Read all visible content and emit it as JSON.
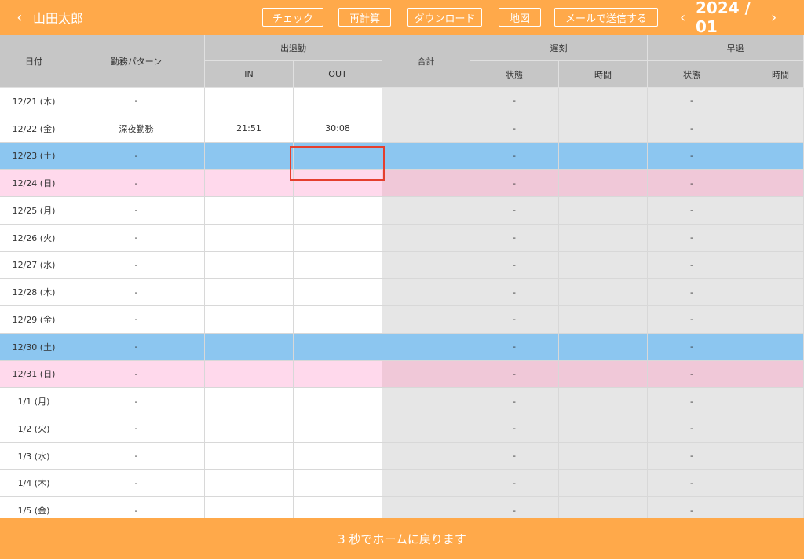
{
  "header": {
    "user_name": "山田太郎",
    "buttons": {
      "check": "チェック",
      "recalc": "再計算",
      "download": "ダウンロード",
      "map": "地図",
      "send_mail": "メールで送信する"
    },
    "month": "2024 / 01"
  },
  "table": {
    "headers": {
      "date": "日付",
      "pattern": "勤務パターン",
      "attendance": "出退勤",
      "in": "IN",
      "out": "OUT",
      "total": "合計",
      "late": "遅刻",
      "early": "早退",
      "status": "状態",
      "time": "時間"
    },
    "rows": [
      {
        "date": "12/21 (木)",
        "pattern": "-",
        "in": "",
        "out": "",
        "late_status": "-",
        "early_status": "-",
        "day": "weekday"
      },
      {
        "date": "12/22 (金)",
        "pattern": "深夜勤務",
        "in": "21:51",
        "out": "30:08",
        "late_status": "-",
        "early_status": "-",
        "day": "weekday"
      },
      {
        "date": "12/23 (土)",
        "pattern": "-",
        "in": "",
        "out": "",
        "late_status": "-",
        "early_status": "-",
        "day": "sat"
      },
      {
        "date": "12/24 (日)",
        "pattern": "-",
        "in": "",
        "out": "",
        "late_status": "-",
        "early_status": "-",
        "day": "sun"
      },
      {
        "date": "12/25 (月)",
        "pattern": "-",
        "in": "",
        "out": "",
        "late_status": "-",
        "early_status": "-",
        "day": "weekday"
      },
      {
        "date": "12/26 (火)",
        "pattern": "-",
        "in": "",
        "out": "",
        "late_status": "-",
        "early_status": "-",
        "day": "weekday"
      },
      {
        "date": "12/27 (水)",
        "pattern": "-",
        "in": "",
        "out": "",
        "late_status": "-",
        "early_status": "-",
        "day": "weekday"
      },
      {
        "date": "12/28 (木)",
        "pattern": "-",
        "in": "",
        "out": "",
        "late_status": "-",
        "early_status": "-",
        "day": "weekday"
      },
      {
        "date": "12/29 (金)",
        "pattern": "-",
        "in": "",
        "out": "",
        "late_status": "-",
        "early_status": "-",
        "day": "weekday"
      },
      {
        "date": "12/30 (土)",
        "pattern": "-",
        "in": "",
        "out": "",
        "late_status": "-",
        "early_status": "-",
        "day": "sat"
      },
      {
        "date": "12/31 (日)",
        "pattern": "-",
        "in": "",
        "out": "",
        "late_status": "-",
        "early_status": "-",
        "day": "sun"
      },
      {
        "date": "1/1 (月)",
        "pattern": "-",
        "in": "",
        "out": "",
        "late_status": "-",
        "early_status": "-",
        "day": "weekday"
      },
      {
        "date": "1/2 (火)",
        "pattern": "-",
        "in": "",
        "out": "",
        "late_status": "-",
        "early_status": "-",
        "day": "weekday"
      },
      {
        "date": "1/3 (水)",
        "pattern": "-",
        "in": "",
        "out": "",
        "late_status": "-",
        "early_status": "-",
        "day": "weekday"
      },
      {
        "date": "1/4 (木)",
        "pattern": "-",
        "in": "",
        "out": "",
        "late_status": "-",
        "early_status": "-",
        "day": "weekday"
      },
      {
        "date": "1/5 (金)",
        "pattern": "-",
        "in": "",
        "out": "",
        "late_status": "-",
        "early_status": "-",
        "day": "weekday"
      }
    ]
  },
  "footer": {
    "message": "3 秒でホームに戻ります"
  },
  "colors": {
    "accent": "#ffa94a",
    "saturday": "#8cc6f0",
    "sunday": "#ffd9ec",
    "highlight": "#e53f2e"
  }
}
